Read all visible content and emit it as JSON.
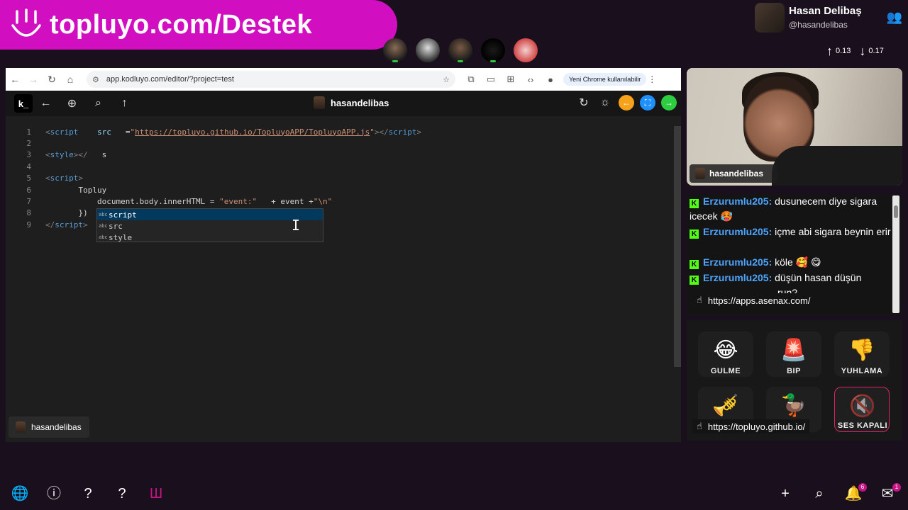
{
  "banner": {
    "text": "topluyo.com/Destek"
  },
  "user": {
    "name": "Hasan Delibaş",
    "handle": "@hasandelibas"
  },
  "stats": {
    "up": "0.13",
    "down": "0.17"
  },
  "avatars": [
    "avatar-1",
    "avatar-2",
    "avatar-3",
    "avatar-4",
    "avatar-5"
  ],
  "browser": {
    "url": "app.kodluyo.com/editor/?project=test",
    "profile_label": "Yeni Chrome kullanılabilir"
  },
  "app": {
    "logo": "k_",
    "center_user": "hasandelibas"
  },
  "editor": {
    "lines": [
      {
        "n": "1",
        "parts": [
          [
            "tag",
            "<"
          ],
          [
            "tagn",
            "script"
          ],
          [
            "code",
            " "
          ],
          [
            "attr",
            "src"
          ],
          [
            "code",
            "="
          ],
          [
            "strp",
            "\""
          ],
          [
            "str",
            "https://topluyo.github.io/TopluyoAPP/TopluyoAPP.js"
          ],
          [
            "strp",
            "\""
          ],
          [
            "tag",
            "></"
          ],
          [
            "tagn",
            "script"
          ],
          [
            "tag",
            ">"
          ]
        ]
      },
      {
        "n": "2",
        "parts": []
      },
      {
        "n": "3",
        "parts": [
          [
            "tag",
            "<"
          ],
          [
            "tagn",
            "style"
          ],
          [
            "tag",
            "></"
          ],
          [
            "code",
            "s"
          ]
        ]
      },
      {
        "n": "4",
        "parts": []
      },
      {
        "n": "5",
        "parts": [
          [
            "tag",
            "<"
          ],
          [
            "tagn",
            "script"
          ],
          [
            "tag",
            ">"
          ]
        ]
      },
      {
        "n": "6",
        "parts": [
          [
            "code",
            "    Topluy"
          ]
        ]
      },
      {
        "n": "7",
        "parts": [
          [
            "code",
            "        document.body.innerHTML = "
          ],
          [
            "strp",
            "\"event:\""
          ],
          [
            "code",
            "+ event +"
          ],
          [
            "strp",
            "\"\\n\""
          ]
        ]
      },
      {
        "n": "8",
        "parts": [
          [
            "code",
            "    })"
          ]
        ]
      },
      {
        "n": "9",
        "parts": [
          [
            "tag",
            "</"
          ],
          [
            "tagn",
            "script"
          ],
          [
            "tag",
            ">"
          ]
        ]
      }
    ],
    "suggestions": [
      "script",
      "src",
      "style"
    ]
  },
  "editor_user": "hasandelibas",
  "camera_label": "hasandelibas",
  "chat": {
    "messages": [
      {
        "user": "Erzurumlu205:",
        "text": " dusunecem diye sigara icecek 🥵"
      },
      {
        "user": "Erzurumlu205:",
        "text": " içme abi sigara beynin erir"
      },
      {
        "user": "Erzurumlu205:",
        "text": " köle 🥰 😋"
      },
      {
        "user": "Erzurumlu205:",
        "text": " düşün hasan düşün"
      }
    ],
    "partial_text": "run?",
    "url_pill": "https://apps.asenax.com/"
  },
  "sounds": [
    {
      "emoji": "😂",
      "label": "GULME"
    },
    {
      "emoji": "🚨",
      "label": "BIP"
    },
    {
      "emoji": "👎",
      "label": "YUHLAMA"
    },
    {
      "emoji": "🎺",
      "label": ""
    },
    {
      "emoji": "🦆",
      "label": ""
    },
    {
      "emoji": "🔇",
      "label": "SES KAPALI"
    }
  ],
  "sounds_url_pill": "https://topluyo.github.io/",
  "bottombar": {
    "notifications": "6",
    "messages": "1"
  }
}
